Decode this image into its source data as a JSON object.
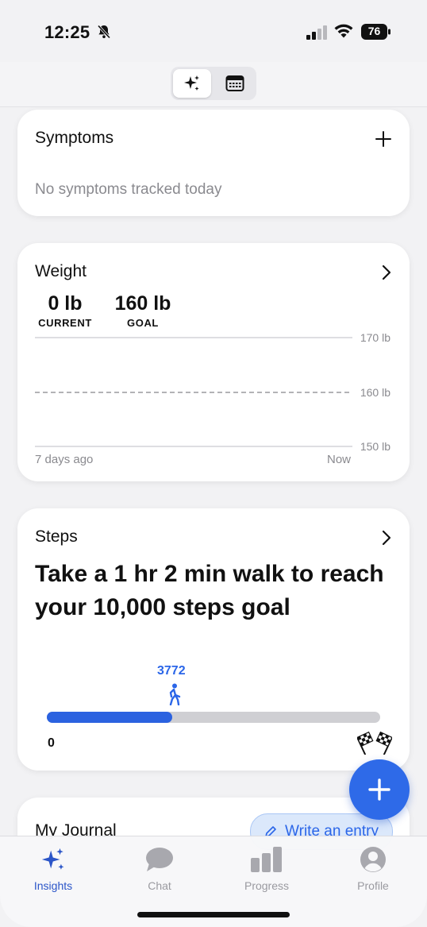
{
  "status": {
    "time": "12:25",
    "battery": "76"
  },
  "symptoms": {
    "title": "Symptoms",
    "empty_text": "No symptoms tracked today"
  },
  "weight": {
    "title": "Weight",
    "current_value": "0 lb",
    "current_label": "CURRENT",
    "goal_value": "160 lb",
    "goal_label": "GOAL",
    "axis_labels": [
      "170 lb",
      "160 lb",
      "150 lb"
    ],
    "x_start": "7 days ago",
    "x_end": "Now"
  },
  "steps": {
    "title": "Steps",
    "headline": "Take a 1 hr 2 min walk to reach your 10,000 steps goal",
    "current": "3772",
    "start_label": "0",
    "progress_fraction": 0.3772
  },
  "journal": {
    "title": "My Journal",
    "write_label": "Write an entry"
  },
  "tabs": [
    {
      "label": "Insights",
      "icon": "sparkles-icon",
      "active": true
    },
    {
      "label": "Chat",
      "icon": "chat-bubble-icon",
      "active": false
    },
    {
      "label": "Progress",
      "icon": "bar-chart-icon",
      "active": false
    },
    {
      "label": "Profile",
      "icon": "person-icon",
      "active": false
    }
  ],
  "colors": {
    "accent": "#2e6ae8",
    "fill": "#2b62e0",
    "track": "#cfcfd3"
  }
}
